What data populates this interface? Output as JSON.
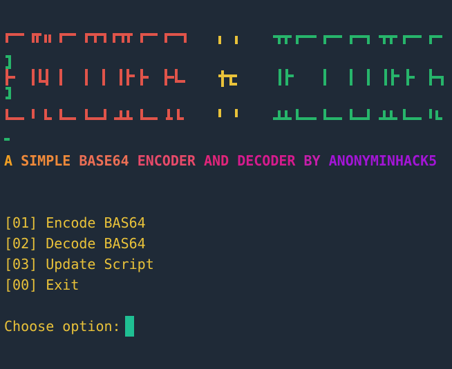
{
  "colors": {
    "background": "#1f2a37",
    "banner_left": "#e0544a",
    "banner_mid": "#e9c23a",
    "banner_right": "#27b56b",
    "menu_text": "#e9c23a",
    "cursor": "#1fbf93"
  },
  "tagline": {
    "parts": [
      {
        "text": "A ",
        "color": "#f2a024"
      },
      {
        "text": "SIMPLE ",
        "color": "#f08a3a"
      },
      {
        "text": "BASE64 ",
        "color": "#ec6f55"
      },
      {
        "text": "ENCODER ",
        "color": "#e84a6a"
      },
      {
        "text": "AND ",
        "color": "#e0257a"
      },
      {
        "text": "DECODER ",
        "color": "#d61b8e"
      },
      {
        "text": "BY ",
        "color": "#c61eab"
      },
      {
        "text": "ANONYMINHACK5",
        "color": "#a315d6"
      }
    ]
  },
  "menu": [
    {
      "key": "[01]",
      "label": "Encode BAS64"
    },
    {
      "key": "[02]",
      "label": "Decode BAS64"
    },
    {
      "key": "[03]",
      "label": "Update Script"
    },
    {
      "key": "[00]",
      "label": "Exit"
    }
  ],
  "prompt": {
    "label": "Choose option:"
  }
}
